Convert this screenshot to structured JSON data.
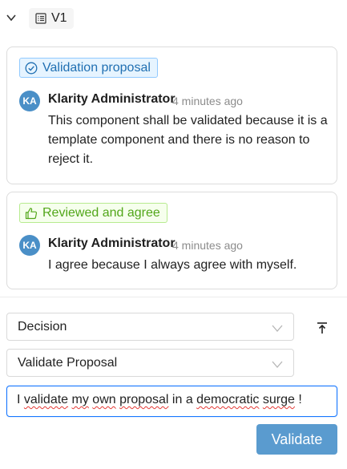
{
  "version": {
    "label": "V1"
  },
  "comments": [
    {
      "badge": "Validation proposal",
      "badge_icon": "check-circle-icon",
      "avatar": "KA",
      "author": "Klarity Administrator",
      "time": "4 minutes ago",
      "text": "This component shall be validated because it is a template component and there is no reason to reject it."
    },
    {
      "badge": "Reviewed and agree",
      "badge_icon": "thumbs-up-icon",
      "avatar": "KA",
      "author": "Klarity Administrator",
      "time": "4 minutes ago",
      "text": "I agree because I always agree with myself."
    }
  ],
  "form": {
    "decision": {
      "value": "Decision"
    },
    "proposal": {
      "value": "Validate Proposal"
    },
    "comment_text": [
      "I",
      " ",
      "validate",
      " ",
      "my",
      " ",
      "own",
      " ",
      "proposal",
      " in a ",
      "democratic",
      " ",
      "surge",
      " !"
    ],
    "submit_label": "Validate"
  },
  "colors": {
    "accent": "#5a9bcf",
    "badge_blue": "#1f6fb2",
    "badge_green": "#52a61a",
    "avatar": "#4a8fc7"
  }
}
